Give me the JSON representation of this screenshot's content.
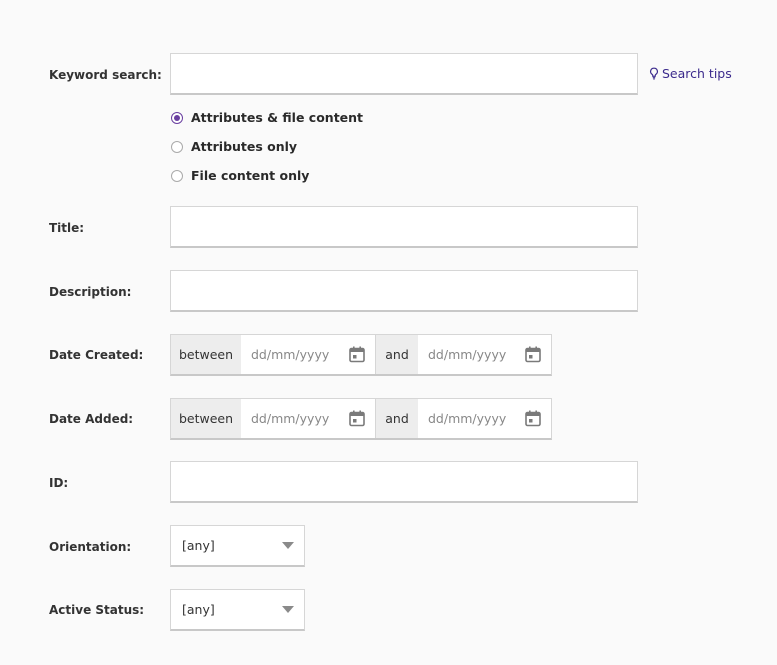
{
  "keyword": {
    "label": "Keyword search:",
    "value": "",
    "search_tips": "Search tips",
    "options": [
      {
        "label": "Attributes & file content",
        "checked": true
      },
      {
        "label": "Attributes only",
        "checked": false
      },
      {
        "label": "File content only",
        "checked": false
      }
    ]
  },
  "title": {
    "label": "Title:",
    "value": ""
  },
  "description": {
    "label": "Description:",
    "value": ""
  },
  "date_created": {
    "label": "Date Created:",
    "between": "between",
    "and": "and",
    "from_placeholder": "dd/mm/yyyy",
    "to_placeholder": "dd/mm/yyyy"
  },
  "date_added": {
    "label": "Date Added:",
    "between": "between",
    "and": "and",
    "from_placeholder": "dd/mm/yyyy",
    "to_placeholder": "dd/mm/yyyy"
  },
  "id": {
    "label": "ID:",
    "value": ""
  },
  "orientation": {
    "label": "Orientation:",
    "selected": "[any]"
  },
  "active_status": {
    "label": "Active Status:",
    "selected": "[any]"
  },
  "colors": {
    "accent": "#6a3fa0",
    "link": "#3b2a8c"
  },
  "icons": {
    "tips": "lightbulb-icon",
    "calendar": "calendar-icon",
    "dropdown": "chevron-down-icon"
  }
}
